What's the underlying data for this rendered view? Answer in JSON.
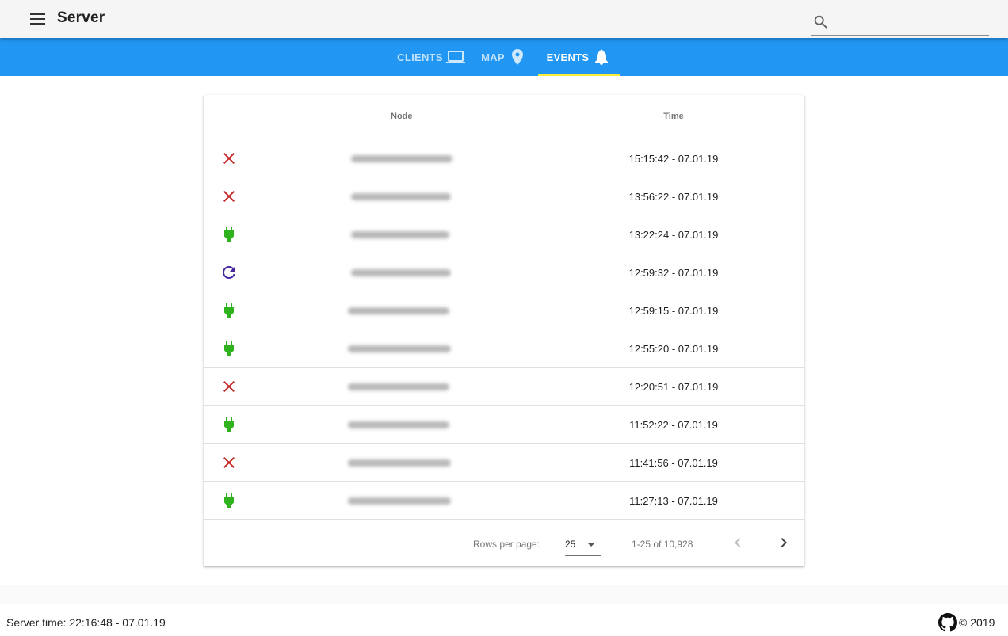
{
  "app": {
    "title": "Server"
  },
  "search": {
    "placeholder": "",
    "value": ""
  },
  "tabs": [
    {
      "label": "CLIENTS",
      "icon": "laptop-icon",
      "active": false
    },
    {
      "label": "MAP",
      "icon": "map-marker-icon",
      "active": false
    },
    {
      "label": "EVENTS",
      "icon": "bell-icon",
      "active": true
    }
  ],
  "colors": {
    "toolbar": "#f5f5f5",
    "tabbar": "#2196f3",
    "tab_indicator": "#ffeb3b",
    "event_disconnect": "#c62828",
    "event_connect": "#2fb21d",
    "event_restart": "#4527a0"
  },
  "table": {
    "headers": {
      "node": "Node",
      "time": "Time"
    },
    "rows": [
      {
        "type": "disconnect",
        "icon": "close-icon",
        "node": "",
        "time": "15:15:42 - 07.01.19"
      },
      {
        "type": "disconnect",
        "icon": "close-icon",
        "node": "",
        "time": "13:56:22 - 07.01.19"
      },
      {
        "type": "connect",
        "icon": "power-plug-icon",
        "node": "",
        "time": "13:22:24 - 07.01.19"
      },
      {
        "type": "restart",
        "icon": "refresh-icon",
        "node": "",
        "time": "12:59:32 - 07.01.19"
      },
      {
        "type": "connect",
        "icon": "power-plug-icon",
        "node": "",
        "time": "12:59:15 - 07.01.19"
      },
      {
        "type": "connect",
        "icon": "power-plug-icon",
        "node": "",
        "time": "12:55:20 - 07.01.19"
      },
      {
        "type": "disconnect",
        "icon": "close-icon",
        "node": "",
        "time": "12:20:51 - 07.01.19"
      },
      {
        "type": "connect",
        "icon": "power-plug-icon",
        "node": "",
        "time": "11:52:22 - 07.01.19"
      },
      {
        "type": "disconnect",
        "icon": "close-icon",
        "node": "",
        "time": "11:41:56 - 07.01.19"
      },
      {
        "type": "connect",
        "icon": "power-plug-icon",
        "node": "",
        "time": "11:27:13 - 07.01.19"
      }
    ]
  },
  "pagination": {
    "rows_per_page_label": "Rows per page:",
    "rows_per_page_value": "25",
    "range_text": "1-25 of 10,928"
  },
  "footer": {
    "server_time": "Server time: 22:16:48 - 07.01.19",
    "copyright": "© 2019"
  }
}
